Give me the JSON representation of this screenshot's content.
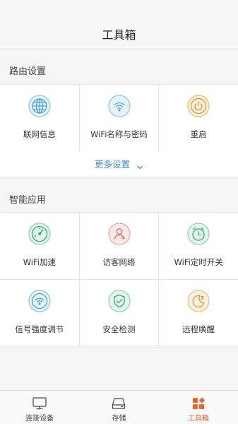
{
  "header": {
    "title": "工具箱"
  },
  "router_settings": {
    "label": "路由设置",
    "items": [
      {
        "label": "联网信息",
        "icon": "globe-icon",
        "color": "#4aa3d8"
      },
      {
        "label": "WiFi名称与密码",
        "icon": "wifi-icon",
        "color": "#4aa3d8"
      },
      {
        "label": "重启",
        "icon": "power-icon",
        "color": "#e39a36"
      }
    ],
    "more": {
      "label": "更多设置",
      "icon": "chevron-down-icon"
    }
  },
  "smart_apps": {
    "label": "智能应用",
    "items": [
      {
        "label": "WiFi加速",
        "icon": "speedometer-icon",
        "color": "#2fae6a"
      },
      {
        "label": "访客网络",
        "icon": "guest-user-icon",
        "color": "#e06a62"
      },
      {
        "label": "WiFi定时开关",
        "icon": "alarm-clock-icon",
        "color": "#2fae6a"
      },
      {
        "label": "信号强度调节",
        "icon": "signal-strength-icon",
        "color": "#4aa3d8"
      },
      {
        "label": "安全检测",
        "icon": "shield-check-icon",
        "color": "#2fae6a"
      },
      {
        "label": "远程唤醒",
        "icon": "moon-sleep-icon",
        "color": "#e39a36"
      }
    ]
  },
  "tabbar": {
    "active_color": "#e9662c",
    "tabs": [
      {
        "label": "连接设备",
        "icon": "monitor-icon",
        "active": false
      },
      {
        "label": "存储",
        "icon": "storage-drive-icon",
        "active": false
      },
      {
        "label": "工具箱",
        "icon": "toolbox-grid-icon",
        "active": true
      }
    ]
  }
}
